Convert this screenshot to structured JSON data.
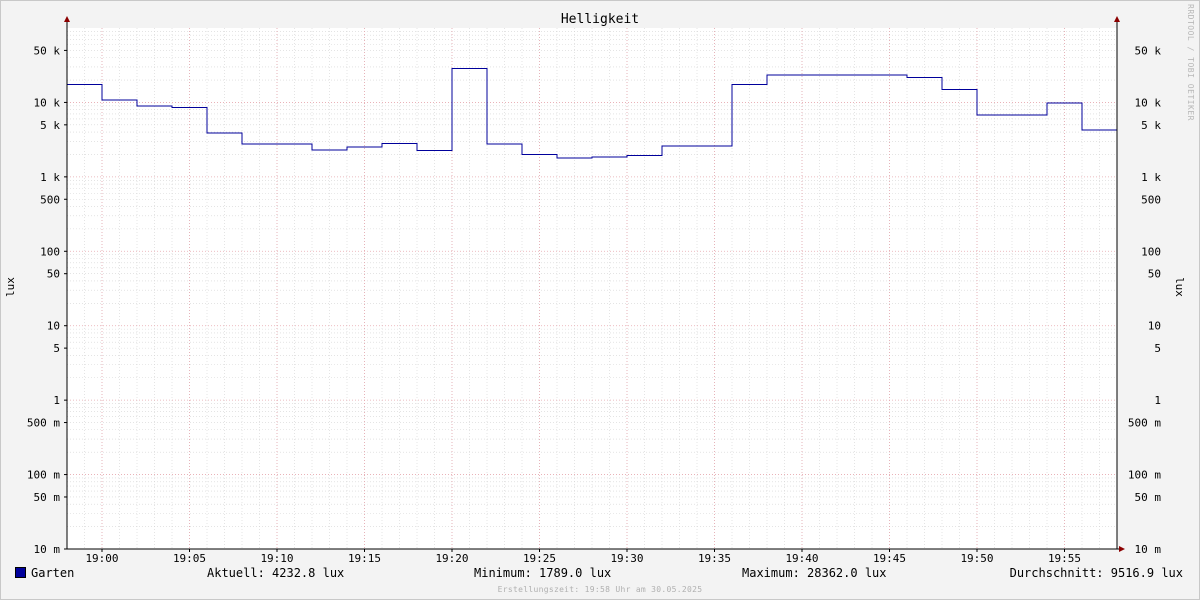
{
  "chart_data": {
    "type": "line",
    "title": "Helligkeit",
    "ylabel": "lux",
    "yscale": "log",
    "ylim": [
      0.01,
      100000
    ],
    "xlim": [
      "18:58",
      "19:58"
    ],
    "y_tick_labels": [
      {
        "value": 50000,
        "label": "50 k"
      },
      {
        "value": 10000,
        "label": "10 k"
      },
      {
        "value": 5000,
        "label": "5 k"
      },
      {
        "value": 1000,
        "label": "1 k"
      },
      {
        "value": 500,
        "label": "500"
      },
      {
        "value": 100,
        "label": "100"
      },
      {
        "value": 50,
        "label": "50"
      },
      {
        "value": 10,
        "label": "10"
      },
      {
        "value": 5,
        "label": "5"
      },
      {
        "value": 1,
        "label": "1"
      },
      {
        "value": 0.5,
        "label": "500 m"
      },
      {
        "value": 0.1,
        "label": "100 m"
      },
      {
        "value": 0.05,
        "label": "50 m"
      },
      {
        "value": 0.01,
        "label": "10 m"
      }
    ],
    "x_tick_labels": [
      "19:00",
      "19:05",
      "19:10",
      "19:15",
      "19:20",
      "19:25",
      "19:30",
      "19:35",
      "19:40",
      "19:45",
      "19:50",
      "19:55"
    ],
    "grid": true,
    "legend": "bottom",
    "series": [
      {
        "name": "Garten",
        "color": "#00009b",
        "step": true,
        "points": [
          {
            "t": "18:58",
            "v": 17500
          },
          {
            "t": "19:00",
            "v": 10800
          },
          {
            "t": "19:02",
            "v": 9000
          },
          {
            "t": "19:04",
            "v": 8500
          },
          {
            "t": "19:06",
            "v": 3900
          },
          {
            "t": "19:08",
            "v": 2750
          },
          {
            "t": "19:12",
            "v": 2300
          },
          {
            "t": "19:14",
            "v": 2500
          },
          {
            "t": "19:16",
            "v": 2800
          },
          {
            "t": "19:18",
            "v": 2250
          },
          {
            "t": "19:20",
            "v": 28362
          },
          {
            "t": "19:22",
            "v": 2750
          },
          {
            "t": "19:24",
            "v": 2000
          },
          {
            "t": "19:26",
            "v": 1789
          },
          {
            "t": "19:28",
            "v": 1850
          },
          {
            "t": "19:30",
            "v": 1950
          },
          {
            "t": "19:32",
            "v": 2600
          },
          {
            "t": "19:36",
            "v": 17500
          },
          {
            "t": "19:38",
            "v": 23500
          },
          {
            "t": "19:46",
            "v": 21500
          },
          {
            "t": "19:48",
            "v": 15000
          },
          {
            "t": "19:50",
            "v": 6800
          },
          {
            "t": "19:54",
            "v": 9800
          },
          {
            "t": "19:56",
            "v": 4232.8
          },
          {
            "t": "19:58",
            "v": 4232.8
          }
        ]
      }
    ]
  },
  "legend": {
    "series_label": "Garten",
    "current": "Aktuell: 4232.8 lux",
    "minimum": "Minimum: 1789.0 lux",
    "maximum": "Maximum: 28362.0 lux",
    "average": "Durchschnitt: 9516.9 lux"
  },
  "footer": {
    "creation": "Erstellungszeit: 19:58 Uhr am 30.05.2025",
    "watermark": "RRDTOOL / TOBI OETIKER"
  },
  "colors": {
    "series": "#00009b",
    "major_grid": "#e6a7ae",
    "minor_grid": "#d3d3d3",
    "arrow": "#8b0000"
  }
}
